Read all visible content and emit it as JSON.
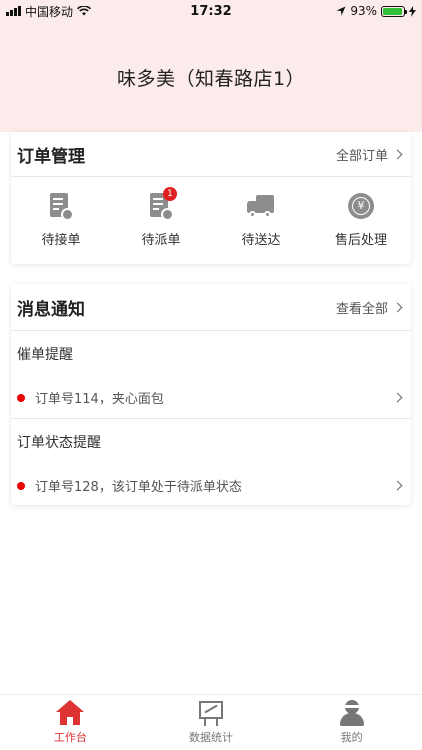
{
  "status_bar": {
    "carrier": "中国移动",
    "time": "17:32",
    "battery": "93%",
    "battery_level": 0.93
  },
  "header": {
    "store_name": "味多美（知春路店1）"
  },
  "order_card": {
    "title": "订单管理",
    "more_label": "全部订单",
    "items": [
      {
        "label": "待接单",
        "icon": "pending-order-icon"
      },
      {
        "label": "待派单",
        "icon": "dispatch-order-icon",
        "badge": "1"
      },
      {
        "label": "待送达",
        "icon": "truck-icon"
      },
      {
        "label": "售后处理",
        "icon": "yuan-coin-icon"
      }
    ]
  },
  "message_card": {
    "title": "消息通知",
    "more_label": "查看全部",
    "groups": [
      {
        "type": "催单提醒",
        "message": "订单号114，夹心面包"
      },
      {
        "type": "订单状态提醒",
        "message": "订单号128，该订单处于待派单状态"
      }
    ]
  },
  "tabbar": {
    "tabs": [
      {
        "label": "工作台",
        "icon": "home-icon",
        "active": true
      },
      {
        "label": "数据统计",
        "icon": "chart-board-icon",
        "active": false
      },
      {
        "label": "我的",
        "icon": "user-icon",
        "active": false
      }
    ]
  },
  "colors": {
    "accent": "#d33333",
    "header_bg": "#fcebeb",
    "badge": "#e02020"
  }
}
